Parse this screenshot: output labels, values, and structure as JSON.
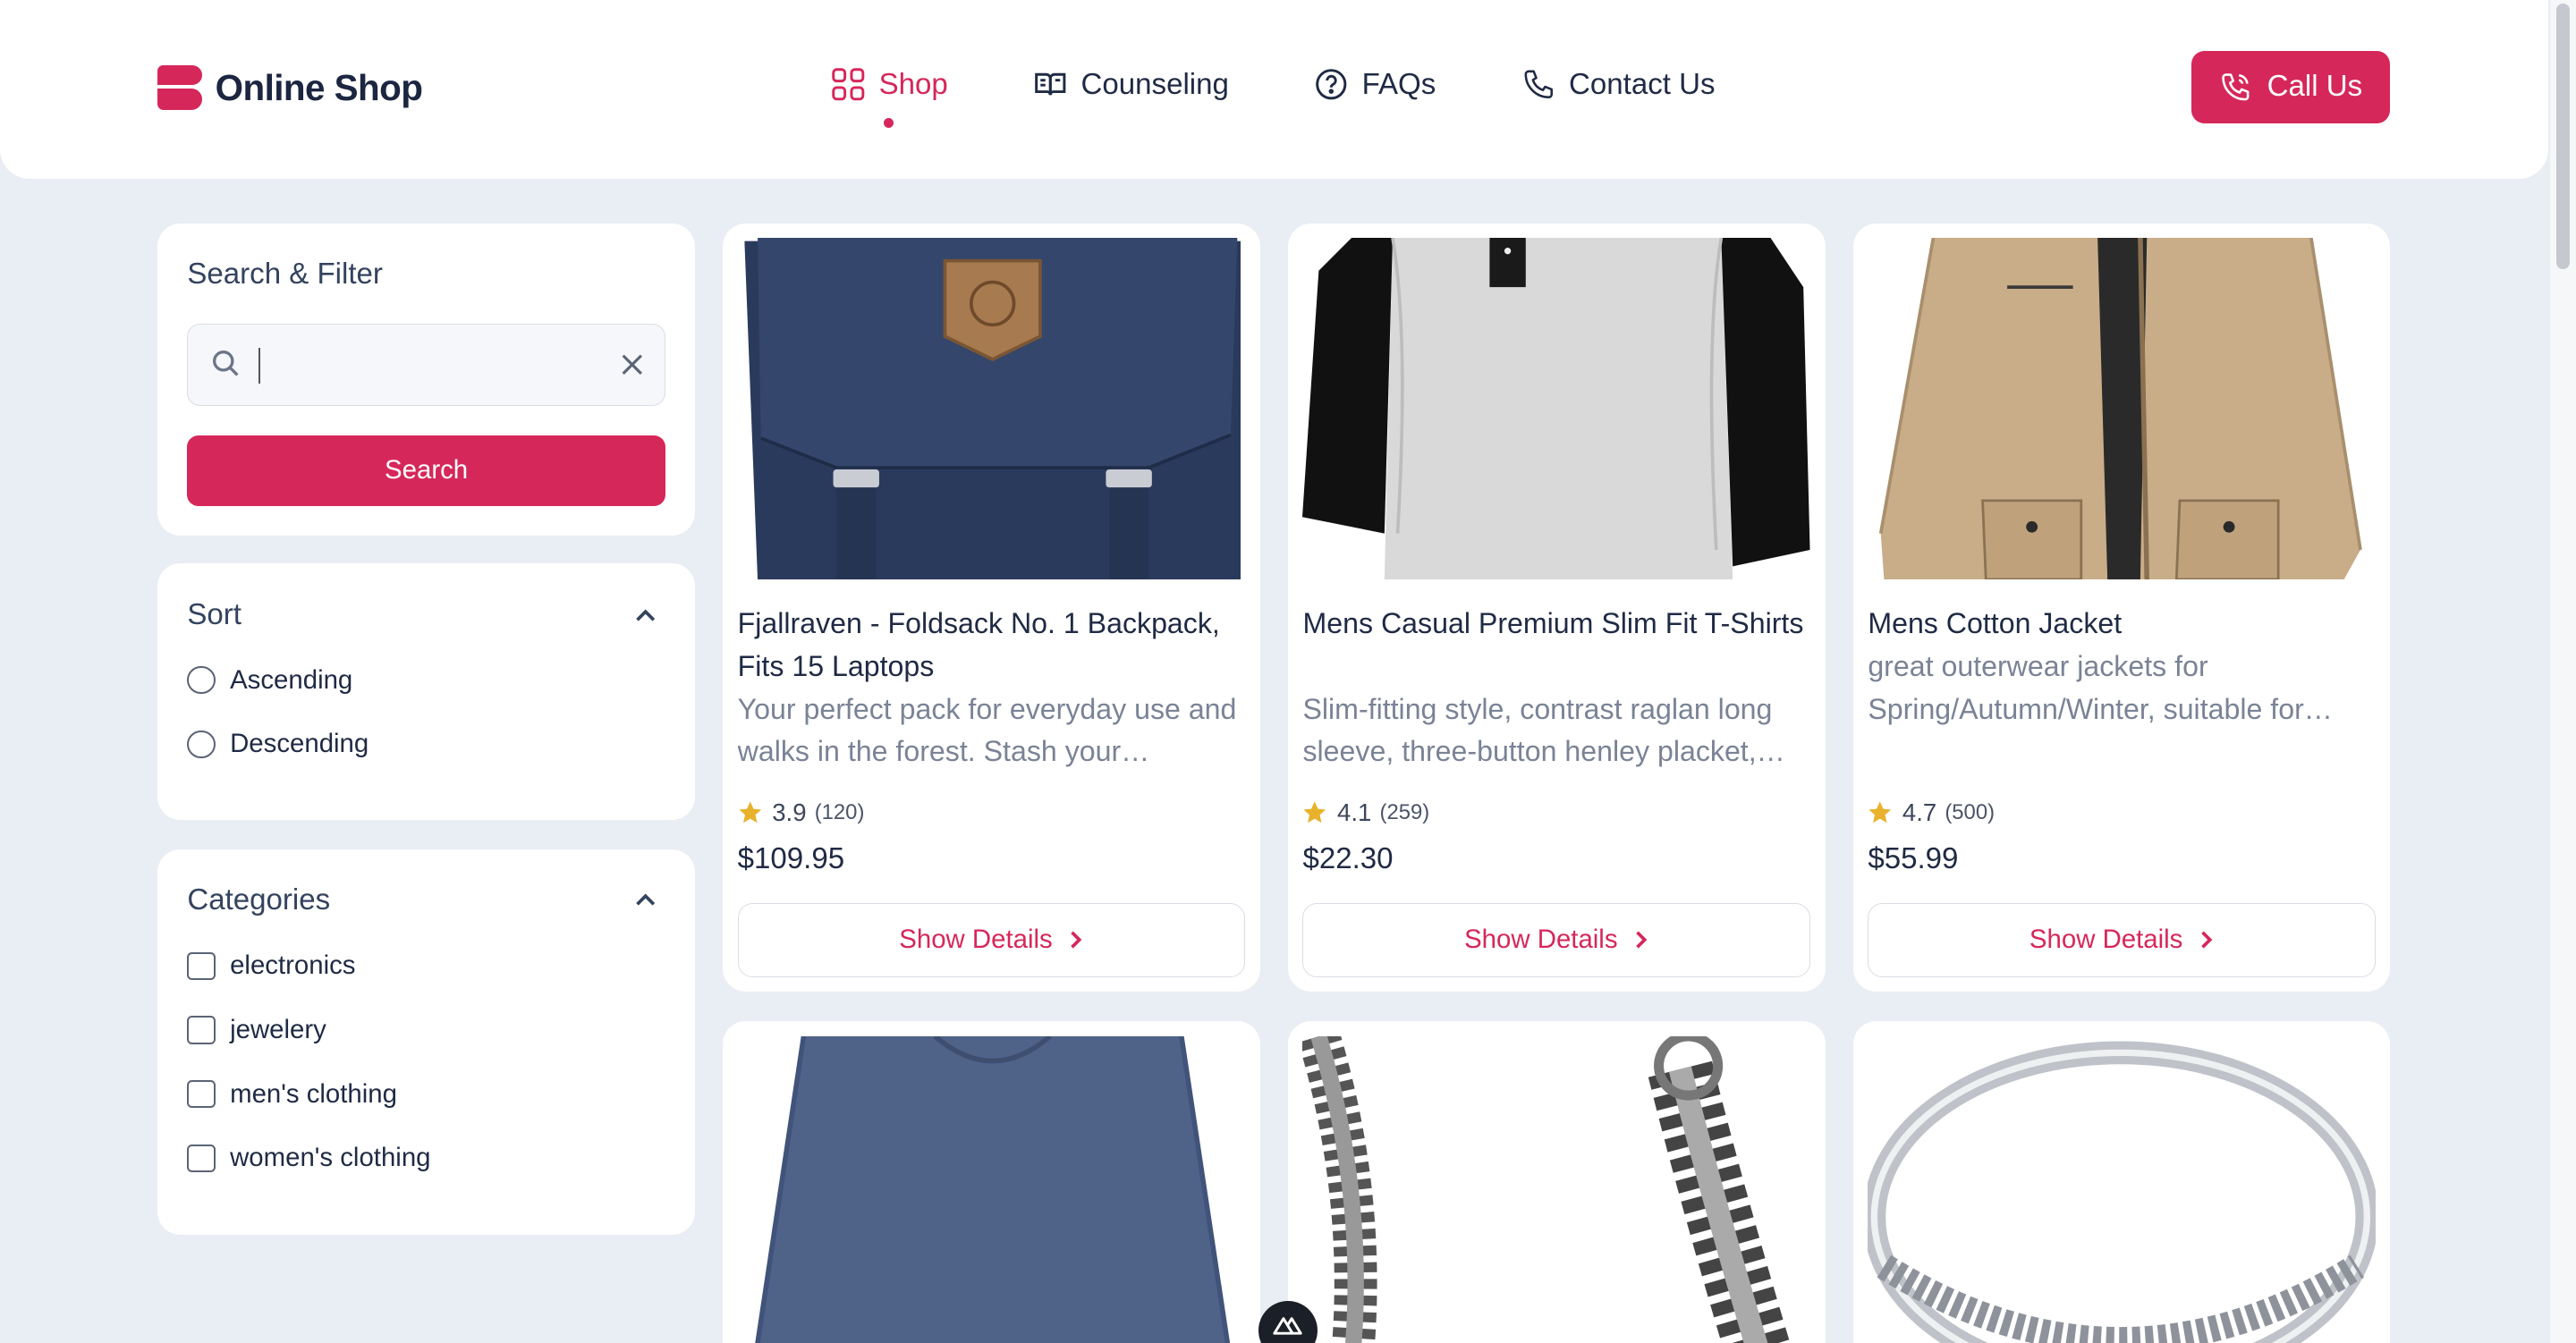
{
  "brand": {
    "name": "Online Shop",
    "accent": "#d6275a"
  },
  "nav": {
    "items": [
      {
        "label": "Shop",
        "icon": "grid-icon",
        "active": true
      },
      {
        "label": "Counseling",
        "icon": "book-open-icon",
        "active": false
      },
      {
        "label": "FAQs",
        "icon": "question-circle-icon",
        "active": false
      },
      {
        "label": "Contact Us",
        "icon": "phone-icon",
        "active": false
      }
    ],
    "call_label": "Call Us"
  },
  "sidebar": {
    "search": {
      "title": "Search & Filter",
      "value": "",
      "placeholder": "",
      "button_label": "Search"
    },
    "sort": {
      "title": "Sort",
      "options": [
        "Ascending",
        "Descending"
      ]
    },
    "categories": {
      "title": "Categories",
      "options": [
        "electronics",
        "jewelery",
        "men's clothing",
        "women's clothing"
      ]
    }
  },
  "products": [
    {
      "title": "Fjallraven - Foldsack No. 1 Backpack, Fits 15 Laptops",
      "description": "Your perfect pack for everyday use and walks in the forest. Stash your…",
      "rating": "3.9",
      "rating_count": "(120)",
      "price": "$109.95",
      "button_label": "Show Details"
    },
    {
      "title": "Mens Casual Premium Slim Fit T-Shirts",
      "description": "Slim-fitting style, contrast raglan long sleeve, three-button henley placket,…",
      "rating": "4.1",
      "rating_count": "(259)",
      "price": "$22.30",
      "button_label": "Show Details"
    },
    {
      "title": "Mens Cotton Jacket",
      "description": "great outerwear jackets for Spring/Autumn/Winter, suitable for…",
      "rating": "4.7",
      "rating_count": "(500)",
      "price": "$55.99",
      "button_label": "Show Details"
    }
  ]
}
